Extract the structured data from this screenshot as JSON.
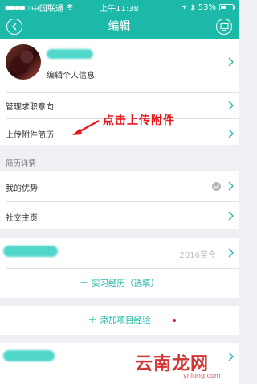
{
  "status_bar": {
    "carrier": "中国联通",
    "time": "上午11:38",
    "battery_text": "53%",
    "battery_level": 0.53
  },
  "nav": {
    "title": "编辑",
    "back_icon": "chevron-left-icon",
    "menu_icon": "monitor-icon"
  },
  "profile": {
    "edit_label": "编辑个人信息"
  },
  "menu": {
    "job_intent": "管理求职意向",
    "upload_resume": "上传附件简历"
  },
  "annotation": {
    "text": "点击上传附件"
  },
  "resume_details": {
    "header": "简历详情",
    "advantage": "我的优势",
    "social": "社交主页"
  },
  "experience": {
    "period": "2016至今",
    "add_internship": "实习经历（选填）",
    "add_project": "添加项目经验"
  },
  "watermark": {
    "text": "云南龙网",
    "url": "ynlong.com"
  },
  "colors": {
    "primary": "#1cb9a8",
    "annotation_red": "#e8141a",
    "background": "#efeff4"
  }
}
